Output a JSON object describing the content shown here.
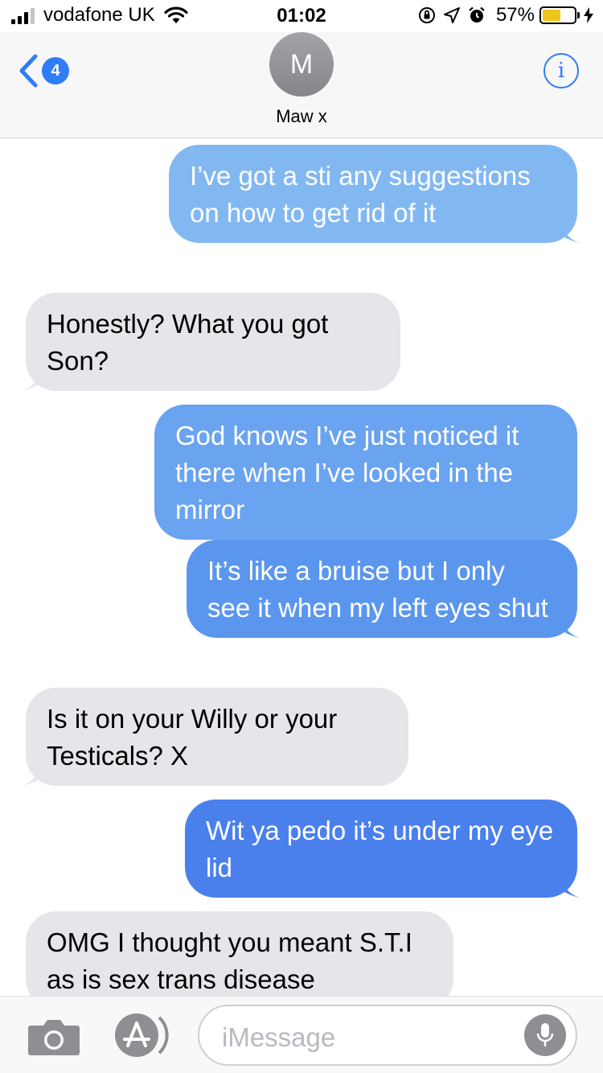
{
  "status_bar": {
    "carrier": "vodafone UK",
    "time": "01:02",
    "battery_percent": "57%",
    "battery_level": 0.57,
    "battery_color": "#f0c419",
    "icons": [
      "signal-icon",
      "wifi-icon",
      "rotation-lock-icon",
      "location-icon",
      "alarm-icon",
      "battery-icon",
      "charging-bolt-icon"
    ]
  },
  "header": {
    "back_badge_count": "4",
    "contact_initial": "M",
    "contact_name": "Maw x",
    "icons": [
      "back-chevron-icon",
      "info-icon"
    ]
  },
  "messages": [
    {
      "direction": "out",
      "text": "I’ve got a sti any suggestions on how to get rid of it",
      "color": "#82b8f2",
      "tail": true
    },
    {
      "direction": "in",
      "text": "Honestly? What you got Son?",
      "color": "#e5e5ea",
      "tail": true
    },
    {
      "direction": "out",
      "text": "God knows I’ve just noticed it there when I’ve looked in the mirror",
      "color": "#6aa3f0",
      "tail": false
    },
    {
      "direction": "out",
      "text": "It’s like a bruise but I only see it when my left eyes shut",
      "color": "#5b96ee",
      "tail": true
    },
    {
      "direction": "in",
      "text": "Is it on your Willy or your Testicals? X",
      "color": "#e5e5ea",
      "tail": true
    },
    {
      "direction": "out",
      "text": "Wit ya pedo it’s under my eye lid",
      "color": "#4a80ec",
      "tail": true
    },
    {
      "direction": "in",
      "text": "OMG I thought you meant S.T.I as is sex trans disease",
      "color": "#e5e5ea",
      "tail": false
    }
  ],
  "input_bar": {
    "placeholder": "iMessage",
    "icons": [
      "camera-icon",
      "app-store-icon",
      "microphone-icon"
    ]
  },
  "colors": {
    "accent": "#2f7df6",
    "incoming_bubble": "#e5e5ea",
    "outgoing_top": "#82b8f2",
    "outgoing_bottom": "#4a80ec"
  }
}
